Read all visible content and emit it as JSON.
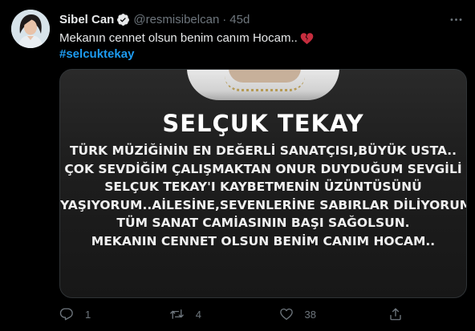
{
  "tweet": {
    "author": {
      "name": "Sibel Can",
      "handle": "@resmisibelcan",
      "separator": "·",
      "time": "45d"
    },
    "text": "Mekanın cennet olsun benim canım Hocam..",
    "emoji": "broken-heart",
    "hashtag": "#selcuktekay",
    "media": {
      "title": "SELÇUK TEKAY",
      "lines": [
        "TÜRK MÜZİĞİNİN EN DEĞERLİ SANATÇISI,BÜYÜK USTA..",
        "ÇOK SEVDİĞİM ÇALIŞMAKTAN ONUR DUYDUĞUM SEVGİLİ",
        "SELÇUK TEKAY'I KAYBETMENİN ÜZÜNTÜSÜNÜ",
        "YAŞIYORUM..AİLESİNE,SEVENLERİNE SABIRLAR DİLİYORUM.",
        "TÜM SANAT CAMİASININ BAŞI SAĞOLSUN.",
        "MEKANIN CENNET OLSUN BENİM CANIM HOCAM.."
      ]
    },
    "actions": {
      "reply_count": "1",
      "retweet_count": "4",
      "like_count": "38"
    }
  },
  "icons": [
    "verified-badge-icon",
    "more-icon",
    "broken-heart-icon",
    "reply-icon",
    "retweet-icon",
    "like-icon",
    "share-icon"
  ],
  "colors": {
    "background": "#000000",
    "text": "#e7e9ea",
    "muted": "#6e767d",
    "link": "#1d9bf0"
  }
}
